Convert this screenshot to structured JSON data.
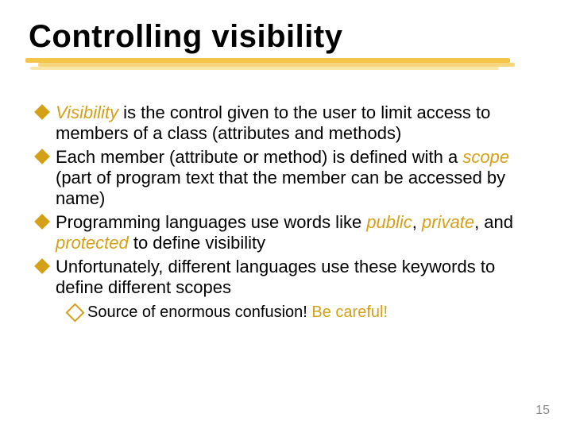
{
  "title": "Controlling visibility",
  "bullets": {
    "b1": {
      "em": "Visibility",
      "rest": " is the control given to the user to limit access to members of a class (attributes and methods)"
    },
    "b2_a": "Each member (attribute or method) is defined with a ",
    "b2_em": "scope",
    "b2_b": " (part of program text that the member can be accessed by name)",
    "b3_a": "Programming languages use words like ",
    "b3_public": "public",
    "b3_c1": ", ",
    "b3_private": "private",
    "b3_c2": ", and ",
    "b3_protected": "protected",
    "b3_b": " to define visibility",
    "b4": "Unfortunately, different languages use these keywords to define different scopes",
    "sub_a": "Source of enormous confusion!  ",
    "sub_em": "Be careful!"
  },
  "page_number": "15"
}
